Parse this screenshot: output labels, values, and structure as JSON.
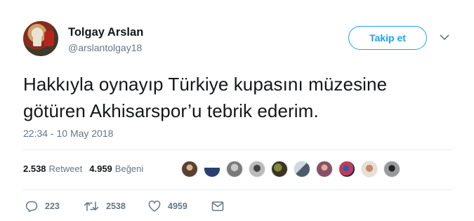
{
  "user": {
    "name": "Tolgay Arslan",
    "handle": "@arslantolgay18"
  },
  "follow_label": "Takip et",
  "tweet": {
    "line1": "Hakkıyla oynayıp Türkiye kupasını müzesine",
    "line2": "götüren Akhisarspor’u tebrik ederim.",
    "timestamp": "22:34 - 10 May 2018"
  },
  "stats": {
    "retweets": "2.538",
    "retweet_label": "Retweet",
    "likes": "4.959",
    "like_label": "Beğeni"
  },
  "actions": {
    "reply_count": "223",
    "retweet_count": "2538",
    "like_count": "4959"
  },
  "icons": [
    "reply-icon",
    "retweet-icon",
    "heart-icon",
    "message-icon",
    "chevron-down-icon"
  ],
  "colors": {
    "accent": "#1da1f2",
    "secondary_text": "#657786",
    "divider": "#e6ecf0"
  }
}
